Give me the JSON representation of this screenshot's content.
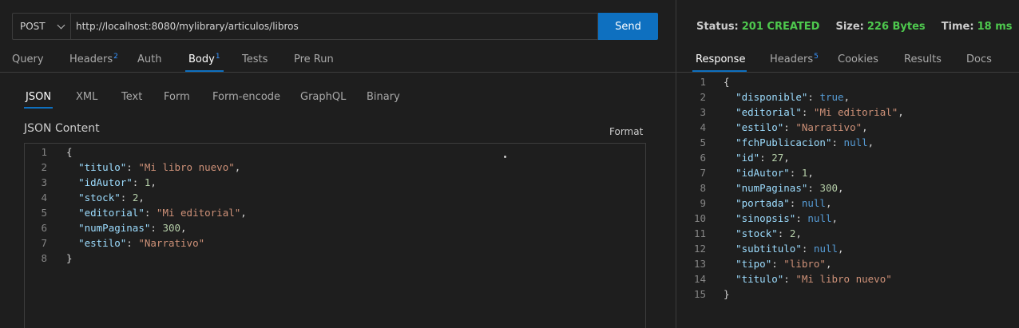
{
  "request": {
    "method": "POST",
    "url": "http://localhost:8080/mylibrary/articulos/libros",
    "send_label": "Send"
  },
  "request_tabs": [
    {
      "label": "Query",
      "count": ""
    },
    {
      "label": "Headers",
      "count": "2"
    },
    {
      "label": "Auth",
      "count": ""
    },
    {
      "label": "Body",
      "count": "1"
    },
    {
      "label": "Tests",
      "count": ""
    },
    {
      "label": "Pre Run",
      "count": ""
    }
  ],
  "body_tabs": [
    "JSON",
    "XML",
    "Text",
    "Form",
    "Form-encode",
    "GraphQL",
    "Binary"
  ],
  "json_content_label": "JSON Content",
  "format_label": "Format",
  "request_body_lines": [
    "{",
    "  \"titulo\": \"Mi libro nuevo\",",
    "  \"idAutor\": 1,",
    "  \"stock\": 2,",
    "  \"editorial\": \"Mi editorial\",",
    "  \"numPaginas\": 300,",
    "  \"estilo\": \"Narrativo\"",
    "}"
  ],
  "response_status": {
    "status_label": "Status:",
    "status_value": "201 CREATED",
    "size_label": "Size:",
    "size_value": "226 Bytes",
    "time_label": "Time:",
    "time_value": "18 ms"
  },
  "response_tabs": [
    {
      "label": "Response",
      "count": ""
    },
    {
      "label": "Headers",
      "count": "5"
    },
    {
      "label": "Cookies",
      "count": ""
    },
    {
      "label": "Results",
      "count": ""
    },
    {
      "label": "Docs",
      "count": ""
    }
  ],
  "response_body_lines": [
    "{",
    "  \"disponible\": true,",
    "  \"editorial\": \"Mi editorial\",",
    "  \"estilo\": \"Narrativo\",",
    "  \"fchPublicacion\": null,",
    "  \"id\": 27,",
    "  \"idAutor\": 1,",
    "  \"numPaginas\": 300,",
    "  \"portada\": null,",
    "  \"sinopsis\": null,",
    "  \"stock\": 2,",
    "  \"subtitulo\": null,",
    "  \"tipo\": \"libro\",",
    "  \"titulo\": \"Mi libro nuevo\"",
    "}"
  ],
  "colors": {
    "accent": "#0e70c0",
    "status_ok": "#4ec94e",
    "json_key": "#9cdcfe",
    "json_string": "#ce9178",
    "json_number": "#b5cea8",
    "json_literal": "#569cd6"
  }
}
